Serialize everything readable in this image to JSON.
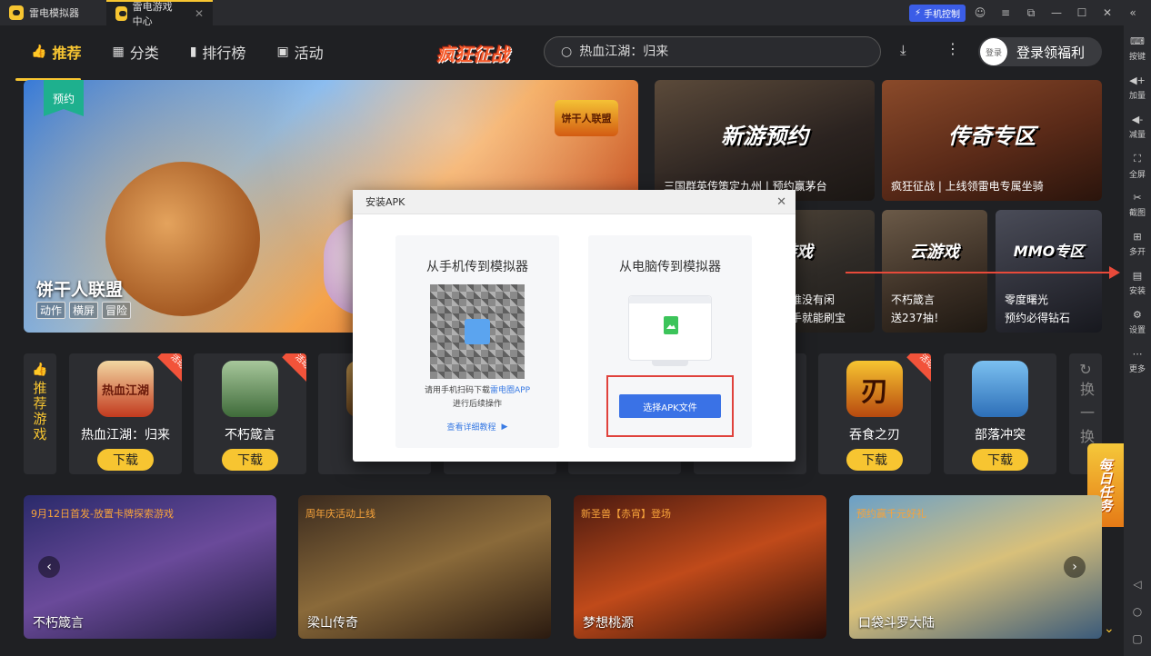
{
  "titlebar": {
    "app_name": "雷电模拟器",
    "tab_label": "雷电游戏中心",
    "phone_control": "手机控制"
  },
  "nav": {
    "items": [
      {
        "label": "推荐",
        "icon": "thumbs-up-icon"
      },
      {
        "label": "分类",
        "icon": "grid-icon"
      },
      {
        "label": "排行榜",
        "icon": "bar-chart-icon"
      },
      {
        "label": "活动",
        "icon": "gift-icon"
      }
    ],
    "logo_text": "疯狂征战",
    "search_placeholder": "热血江湖：归来",
    "login_avatar": "登录",
    "login_label": "登录领福利"
  },
  "hero": {
    "badge": "预约",
    "title": "饼干人联盟",
    "tags": [
      "动作",
      "横屏",
      "冒险"
    ],
    "logo": "饼干人联盟"
  },
  "promos": [
    {
      "heading": "新游预约",
      "caption": "三国群英传策定九州 | 预约赢茅台"
    },
    {
      "heading": "传奇专区",
      "caption": "疯狂征战 | 上线领雷电专属坐骑"
    },
    {
      "heading": "小游戏",
      "caption_1": "谁没有闲",
      "caption_2": "手就能刷宝"
    },
    {
      "heading": "云游戏",
      "caption_1": "不朽箴言",
      "caption_2": "送237抽！"
    },
    {
      "heading": "MMO专区",
      "caption_1": "零度曙光",
      "caption_2": "预约必得钻石"
    }
  ],
  "recommend": {
    "label": "推荐游戏",
    "swap_label": "换一换",
    "download_label": "下载",
    "hot_label": "活动",
    "games": [
      {
        "name": "热血江湖：归来",
        "icon_text": "热血江湖"
      },
      {
        "name": "不朽箴言",
        "icon_text": ""
      },
      {
        "name": "吞食之刃",
        "icon_text": "刃"
      },
      {
        "name": "部落冲突",
        "icon_text": ""
      }
    ]
  },
  "daily_task": "每日任务",
  "bottom_banners": [
    {
      "top": "9月12日首发-放置卡牌探索游戏",
      "bottom": "不朽箴言"
    },
    {
      "top": "周年庆活动上线",
      "bottom": "梁山传奇"
    },
    {
      "top": "新圣兽【赤宵】登场",
      "bottom": "梦想桃源"
    },
    {
      "top": "预约赢千元好礼",
      "bottom": "口袋斗罗大陆"
    }
  ],
  "right_toolbar": [
    {
      "label": "按键",
      "icon": "keyboard-icon"
    },
    {
      "label": "加量",
      "icon": "volume-up-icon"
    },
    {
      "label": "减量",
      "icon": "volume-down-icon"
    },
    {
      "label": "全屏",
      "icon": "fullscreen-icon"
    },
    {
      "label": "截图",
      "icon": "scissors-icon"
    },
    {
      "label": "多开",
      "icon": "multi-instance-icon"
    },
    {
      "label": "安装",
      "icon": "install-apk-icon"
    },
    {
      "label": "设置",
      "icon": "gear-icon"
    },
    {
      "label": "更多",
      "icon": "more-icon"
    }
  ],
  "dialog": {
    "title": "安装APK",
    "phone_panel": {
      "title": "从手机传到模拟器",
      "hint_prefix": "请用手机扫码下载",
      "hint_link": "雷电圈APP",
      "hint_suffix": "进行后续操作",
      "tutorial": "查看详细教程"
    },
    "pc_panel": {
      "title": "从电脑传到模拟器",
      "button": "选择APK文件"
    }
  },
  "colors": {
    "accent": "#f7c531",
    "dialog_button": "#3a72e6",
    "highlight_red": "#e0423c"
  }
}
